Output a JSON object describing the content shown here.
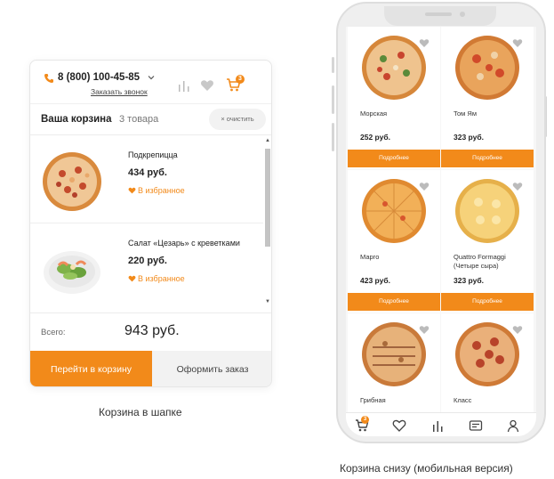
{
  "desktop_cart": {
    "phone_number": "8 (800) 100-45-85",
    "callback_link": "Заказать звонок",
    "cart_badge": "3",
    "cart_title": "Ваша корзина",
    "cart_count": "3 товара",
    "clear_button": "× очистить",
    "items": [
      {
        "name": "Подкрепицца",
        "price": "434 руб.",
        "favorite": "В избранное"
      },
      {
        "name": "Салат «Цезарь» с креветками",
        "price": "220 руб.",
        "favorite": "В избранное"
      }
    ],
    "total_label": "Всего:",
    "total_value": "943 руб.",
    "go_to_cart_button": "Перейти в корзину",
    "checkout_button": "Оформить заказ"
  },
  "caption_left": "Корзина в шапке",
  "caption_right": "Корзина снизу (мобильная версия)",
  "mobile": {
    "products": [
      {
        "name": "Морская",
        "price": "252 руб.",
        "button": "Подробнее"
      },
      {
        "name": "Том Ям",
        "price": "323 руб.",
        "button": "Подробнее"
      },
      {
        "name": "Марго",
        "price": "423 руб.",
        "button": "Подробнее"
      },
      {
        "name": "Quattro Formaggi (Четыре сыра)",
        "price": "323 руб.",
        "button": "Подробнее"
      },
      {
        "name": "Грибная",
        "price": "",
        "button": ""
      },
      {
        "name": "Класс",
        "price": "",
        "button": ""
      }
    ],
    "cart_badge": "3",
    "tabs": [
      "cart-icon",
      "heart-icon",
      "stats-icon",
      "menu-icon",
      "user-icon"
    ]
  },
  "colors": {
    "accent": "#f28a1a",
    "border": "#e6e6e6",
    "muted_bg": "#f2f2f2"
  }
}
